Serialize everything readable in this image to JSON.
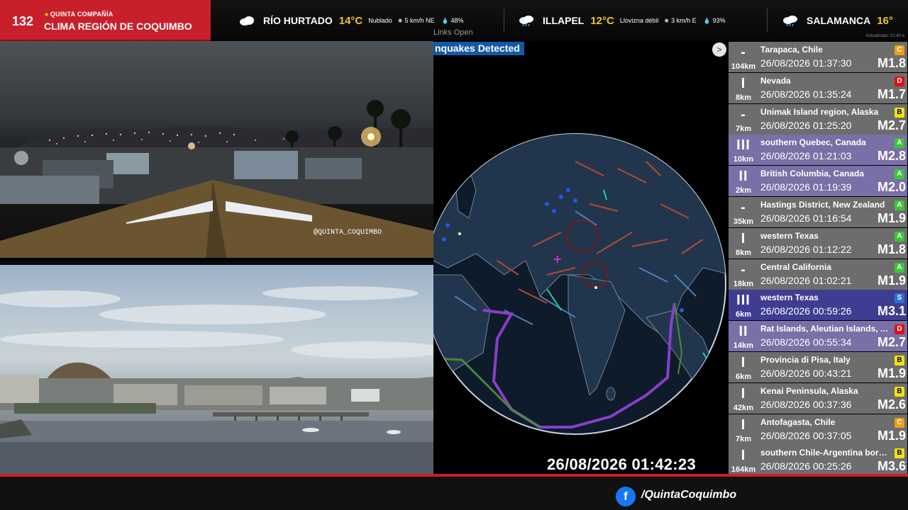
{
  "brand": {
    "number": "132",
    "company": "QUINTA COMPAÑÍA",
    "region_title": "CLIMA REGIÓN DE COQUIMBO"
  },
  "weather": [
    {
      "city": "RÍO HURTADO",
      "temp": "14°C",
      "condition": "Nublado",
      "wind": "5 km/h NE",
      "humidity": "48%",
      "icon": "cloud-icon"
    },
    {
      "city": "ILLAPEL",
      "temp": "12°C",
      "condition": "Llovizna débil",
      "wind": "3 km/h E",
      "humidity": "93%",
      "icon": "drizzle-cloud-icon"
    },
    {
      "city": "SALAMANCA",
      "temp": "16°",
      "icon": "drizzle-cloud-icon"
    }
  ],
  "weather_updated": "Actualizado: 01:40 a",
  "camera": {
    "watermark": "@QUINTA_COQUIMBO"
  },
  "map": {
    "title": "nquakes Detected",
    "links_text": "Links  Open",
    "timestamp": "26/08/2026 01:42:23"
  },
  "quakes": [
    {
      "mmi": "-",
      "depth": "104km",
      "location": "Tarapaca, Chile",
      "time": "26/08/2026 01:37:30",
      "mag": "M1.8",
      "grade": "C",
      "grade_color": "#f39c12",
      "bg": "grey"
    },
    {
      "mmi": "I",
      "depth": "8km",
      "location": "Nevada",
      "time": "26/08/2026 01:35:24",
      "mag": "M1.7",
      "grade": "D",
      "grade_color": "#e01010",
      "bg": "grey"
    },
    {
      "mmi": "-",
      "depth": "7km",
      "location": "Unimak Island region, Alaska",
      "time": "26/08/2026 01:25:20",
      "mag": "M2.7",
      "grade": "B",
      "grade_color": "#f5e20c",
      "bg": "grey"
    },
    {
      "mmi": "III",
      "depth": "10km",
      "location": "southern Quebec, Canada",
      "time": "26/08/2026 01:21:03",
      "mag": "M2.8",
      "grade": "A",
      "grade_color": "#39c834",
      "bg": "mid"
    },
    {
      "mmi": "II",
      "depth": "2km",
      "location": "British Columbia, Canada",
      "time": "26/08/2026 01:19:39",
      "mag": "M2.0",
      "grade": "A",
      "grade_color": "#39c834",
      "bg": "mid"
    },
    {
      "mmi": "-",
      "depth": "35km",
      "location": "Hastings District, New Zealand",
      "time": "26/08/2026 01:16:54",
      "mag": "M1.9",
      "grade": "A",
      "grade_color": "#39c834",
      "bg": "grey"
    },
    {
      "mmi": "I",
      "depth": "8km",
      "location": "western Texas",
      "time": "26/08/2026 01:12:22",
      "mag": "M1.8",
      "grade": "A",
      "grade_color": "#39c834",
      "bg": "grey"
    },
    {
      "mmi": "-",
      "depth": "18km",
      "location": "Central California",
      "time": "26/08/2026 01:02:21",
      "mag": "M1.9",
      "grade": "A",
      "grade_color": "#39c834",
      "bg": "grey"
    },
    {
      "mmi": "III",
      "depth": "6km",
      "location": "western Texas",
      "time": "26/08/2026 00:59:26",
      "mag": "M3.1",
      "grade": "S",
      "grade_color": "#2b6fd6",
      "bg": "big"
    },
    {
      "mmi": "II",
      "depth": "14km",
      "location": "Rat Islands, Aleutian Islands, Alaska",
      "time": "26/08/2026 00:55:34",
      "mag": "M2.7",
      "grade": "D",
      "grade_color": "#e01010",
      "bg": "mid"
    },
    {
      "mmi": "I",
      "depth": "6km",
      "location": "Provincia di Pisa, Italy",
      "time": "26/08/2026 00:43:21",
      "mag": "M1.9",
      "grade": "B",
      "grade_color": "#f5e20c",
      "bg": "grey"
    },
    {
      "mmi": "I",
      "depth": "42km",
      "location": "Kenai Peninsula, Alaska",
      "time": "26/08/2026 00:37:36",
      "mag": "M2.6",
      "grade": "B",
      "grade_color": "#f5e20c",
      "bg": "grey"
    },
    {
      "mmi": "I",
      "depth": "7km",
      "location": "Antofagasta, Chile",
      "time": "26/08/2026 00:37:05",
      "mag": "M1.9",
      "grade": "C",
      "grade_color": "#f39c12",
      "bg": "grey"
    },
    {
      "mmi": "I",
      "depth": "164km",
      "location": "southern Chile-Argentina border region",
      "time": "26/08/2026 00:25:26",
      "mag": "M3.6",
      "grade": "B",
      "grade_color": "#f5e20c",
      "bg": "grey"
    }
  ],
  "footer": {
    "facebook_icon": "facebook-icon",
    "handle": "/QuintaCoquimbo"
  }
}
